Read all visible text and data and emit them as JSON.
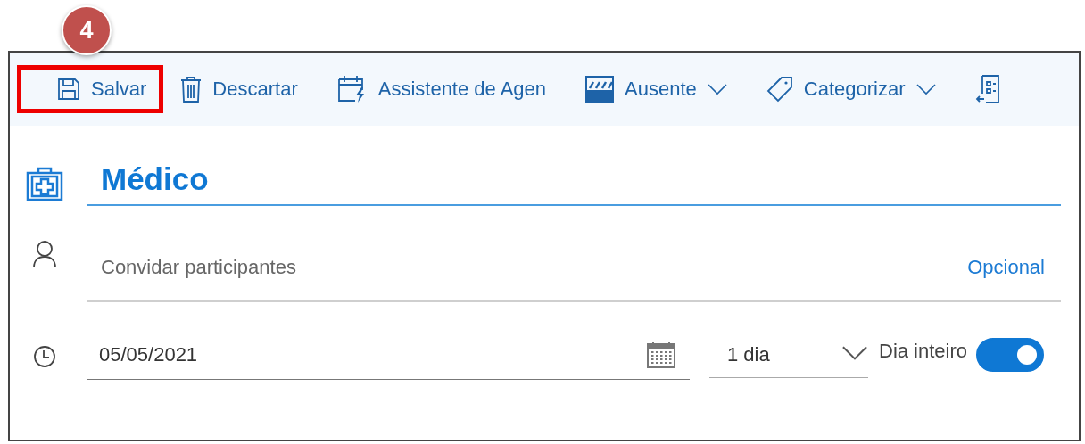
{
  "callout": {
    "number": "4"
  },
  "toolbar": [
    {
      "kind": "save",
      "label": "Salvar",
      "highlighted": true,
      "dropdown": false
    },
    {
      "kind": "discard",
      "label": "Descartar",
      "highlighted": false,
      "dropdown": false
    },
    {
      "kind": "assistant",
      "label": "Assistente de Agen",
      "highlighted": false,
      "dropdown": false
    },
    {
      "kind": "away",
      "label": "Ausente",
      "highlighted": false,
      "dropdown": true
    },
    {
      "kind": "tag",
      "label": "Categorizar",
      "highlighted": false,
      "dropdown": true
    },
    {
      "kind": "more",
      "highlighted": false,
      "dropdown": false
    }
  ],
  "event": {
    "title": "Médico",
    "attendees": {
      "placeholder": "Convidar participantes",
      "optional_link": "Opcional"
    },
    "date": "05/05/2021",
    "duration": "1 dia",
    "all_day": {
      "label": "Dia inteiro",
      "on": true
    }
  }
}
